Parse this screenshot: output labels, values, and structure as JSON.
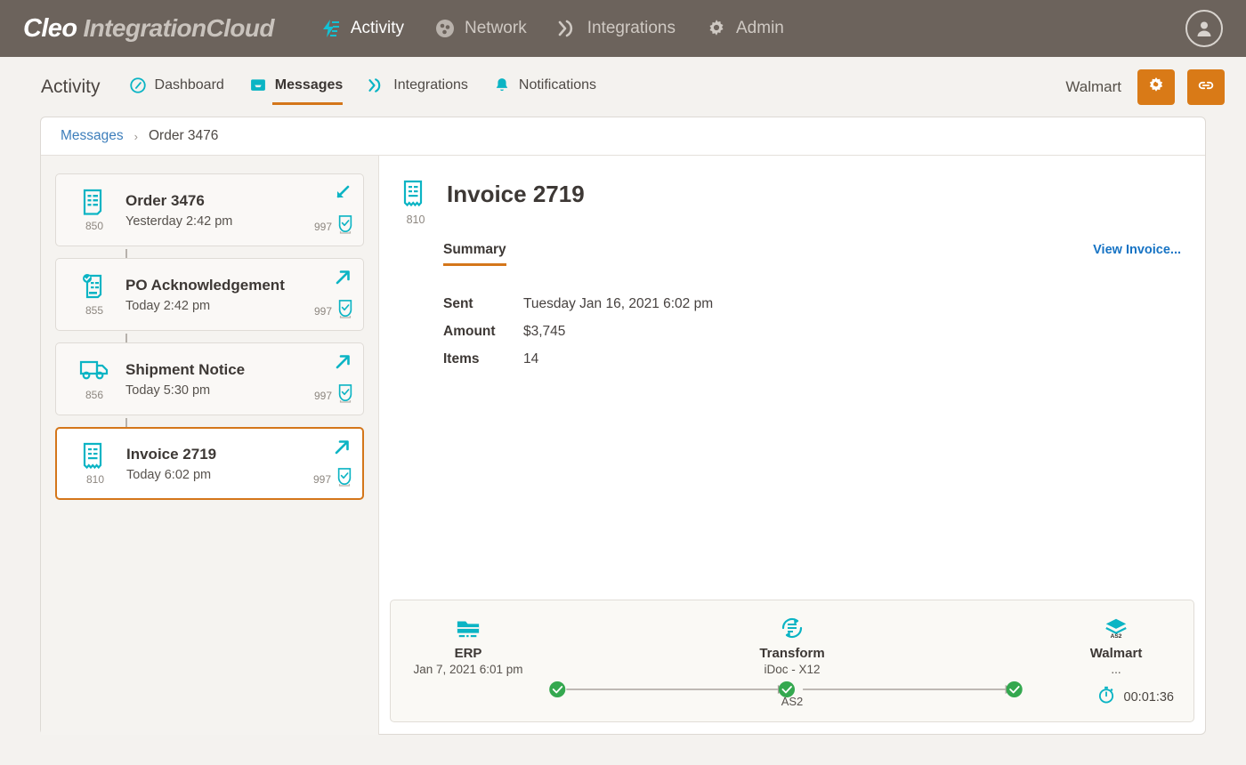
{
  "header": {
    "brand_primary": "Cleo",
    "brand_secondary": "IntegrationCloud",
    "nav": [
      {
        "label": "Activity",
        "icon": "activity-bolt-icon",
        "active": true
      },
      {
        "label": "Network",
        "icon": "network-nodes-icon",
        "active": false
      },
      {
        "label": "Integrations",
        "icon": "integrations-chevrons-icon",
        "active": false
      },
      {
        "label": "Admin",
        "icon": "gear-icon",
        "active": false
      }
    ],
    "avatar_icon": "user-avatar-icon"
  },
  "subheader": {
    "section_title": "Activity",
    "tabs": [
      {
        "label": "Dashboard",
        "icon": "dashboard-gauge-icon",
        "active": false
      },
      {
        "label": "Messages",
        "icon": "messages-inbox-icon",
        "active": true
      },
      {
        "label": "Integrations",
        "icon": "integrations-chevrons-icon",
        "active": false
      },
      {
        "label": "Notifications",
        "icon": "bell-icon",
        "active": false
      }
    ],
    "tenant": "Walmart",
    "buttons": [
      {
        "icon": "settings-gear-refresh-icon",
        "name": "settings-button"
      },
      {
        "icon": "link-chain-icon",
        "name": "link-button"
      }
    ]
  },
  "breadcrumb": {
    "root": "Messages",
    "separator": "›",
    "current": "Order 3476"
  },
  "messages": [
    {
      "code": "850",
      "title": "Order 3476",
      "time": "Yesterday 2:42 pm",
      "direction": "inbound",
      "ack_code": "997",
      "icon": "document-lines-icon",
      "selected": false
    },
    {
      "code": "855",
      "title": "PO Acknowledgement",
      "time": "Today 2:42 pm",
      "direction": "outbound",
      "ack_code": "997",
      "icon": "document-check-icon",
      "selected": false
    },
    {
      "code": "856",
      "title": "Shipment Notice",
      "time": "Today 5:30 pm",
      "direction": "outbound",
      "ack_code": "997",
      "icon": "truck-icon",
      "selected": false
    },
    {
      "code": "810",
      "title": "Invoice 2719",
      "time": "Today 6:02 pm",
      "direction": "outbound",
      "ack_code": "997",
      "icon": "receipt-icon",
      "selected": true
    }
  ],
  "detail": {
    "code": "810",
    "title": "Invoice 2719",
    "icon": "receipt-icon",
    "tabs": [
      {
        "label": "Summary",
        "active": true
      }
    ],
    "view_link": "View Invoice...",
    "fields": [
      {
        "label": "Sent",
        "value": "Tuesday Jan 16, 2021 6:02 pm"
      },
      {
        "label": "Amount",
        "value": "$3,745"
      },
      {
        "label": "Items",
        "value": "14"
      }
    ]
  },
  "flow": {
    "nodes": [
      {
        "name": "ERP",
        "sub": "Jan 7, 2021  6:01 pm",
        "icon": "server-folder-icon",
        "status": "success"
      },
      {
        "name": "Transform",
        "sub": "iDoc - X12",
        "icon": "transform-refresh-icon",
        "status": "success"
      },
      {
        "name": "Walmart",
        "sub": "...",
        "icon": "layers-as2-icon",
        "status": "success"
      }
    ],
    "connector_label": "AS2",
    "elapsed": "00:01:36",
    "timer_icon": "stopwatch-icon"
  },
  "colors": {
    "brand_bar": "#6c635c",
    "accent_orange": "#d4761a",
    "teal": "#0bb4c4",
    "link_blue": "#1673c4",
    "success_green": "#34a84f"
  }
}
